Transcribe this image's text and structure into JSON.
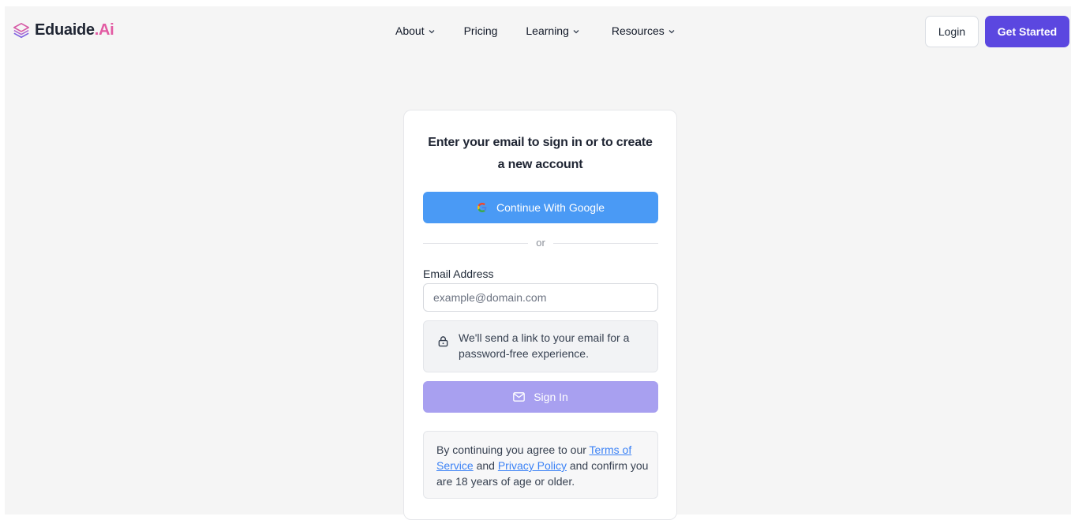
{
  "brand": {
    "name": "Eduaide",
    "suffix": ".Ai"
  },
  "nav": {
    "items": [
      {
        "label": "About",
        "has_dropdown": true
      },
      {
        "label": "Pricing",
        "has_dropdown": false
      },
      {
        "label": "Learning",
        "has_dropdown": true
      },
      {
        "label": "Resources",
        "has_dropdown": true
      }
    ]
  },
  "header": {
    "login_label": "Login",
    "get_started_label": "Get Started"
  },
  "auth_card": {
    "title_line1": "Enter your email to sign in or to create",
    "title_line2": "a new account",
    "google_button_label": "Continue With Google",
    "divider_label": "or",
    "email_label": "Email Address",
    "email_placeholder": "example@domain.com",
    "email_value": "",
    "info_text": "We'll send a link to your email for a password-free experience.",
    "sign_in_label": "Sign In",
    "terms": {
      "prefix": "By continuing you agree to our ",
      "terms_link": "Terms of Service",
      "and": " and ",
      "privacy_link": "Privacy Policy",
      "suffix": " and confirm you are 18 years of age or older."
    }
  },
  "icons": {
    "logo": "layered-stack-icon",
    "google": "google-g-icon",
    "lock": "lock-icon",
    "mail": "mail-icon",
    "chevron": "chevron-down-icon"
  },
  "colors": {
    "page_background": "#f5f5f5",
    "brand_accent": "#e25aa2",
    "primary_button": "#5b47e0",
    "google_button": "#4a9af5",
    "sign_in_button_disabled": "#a8a0f0",
    "link": "#3b82f6"
  }
}
